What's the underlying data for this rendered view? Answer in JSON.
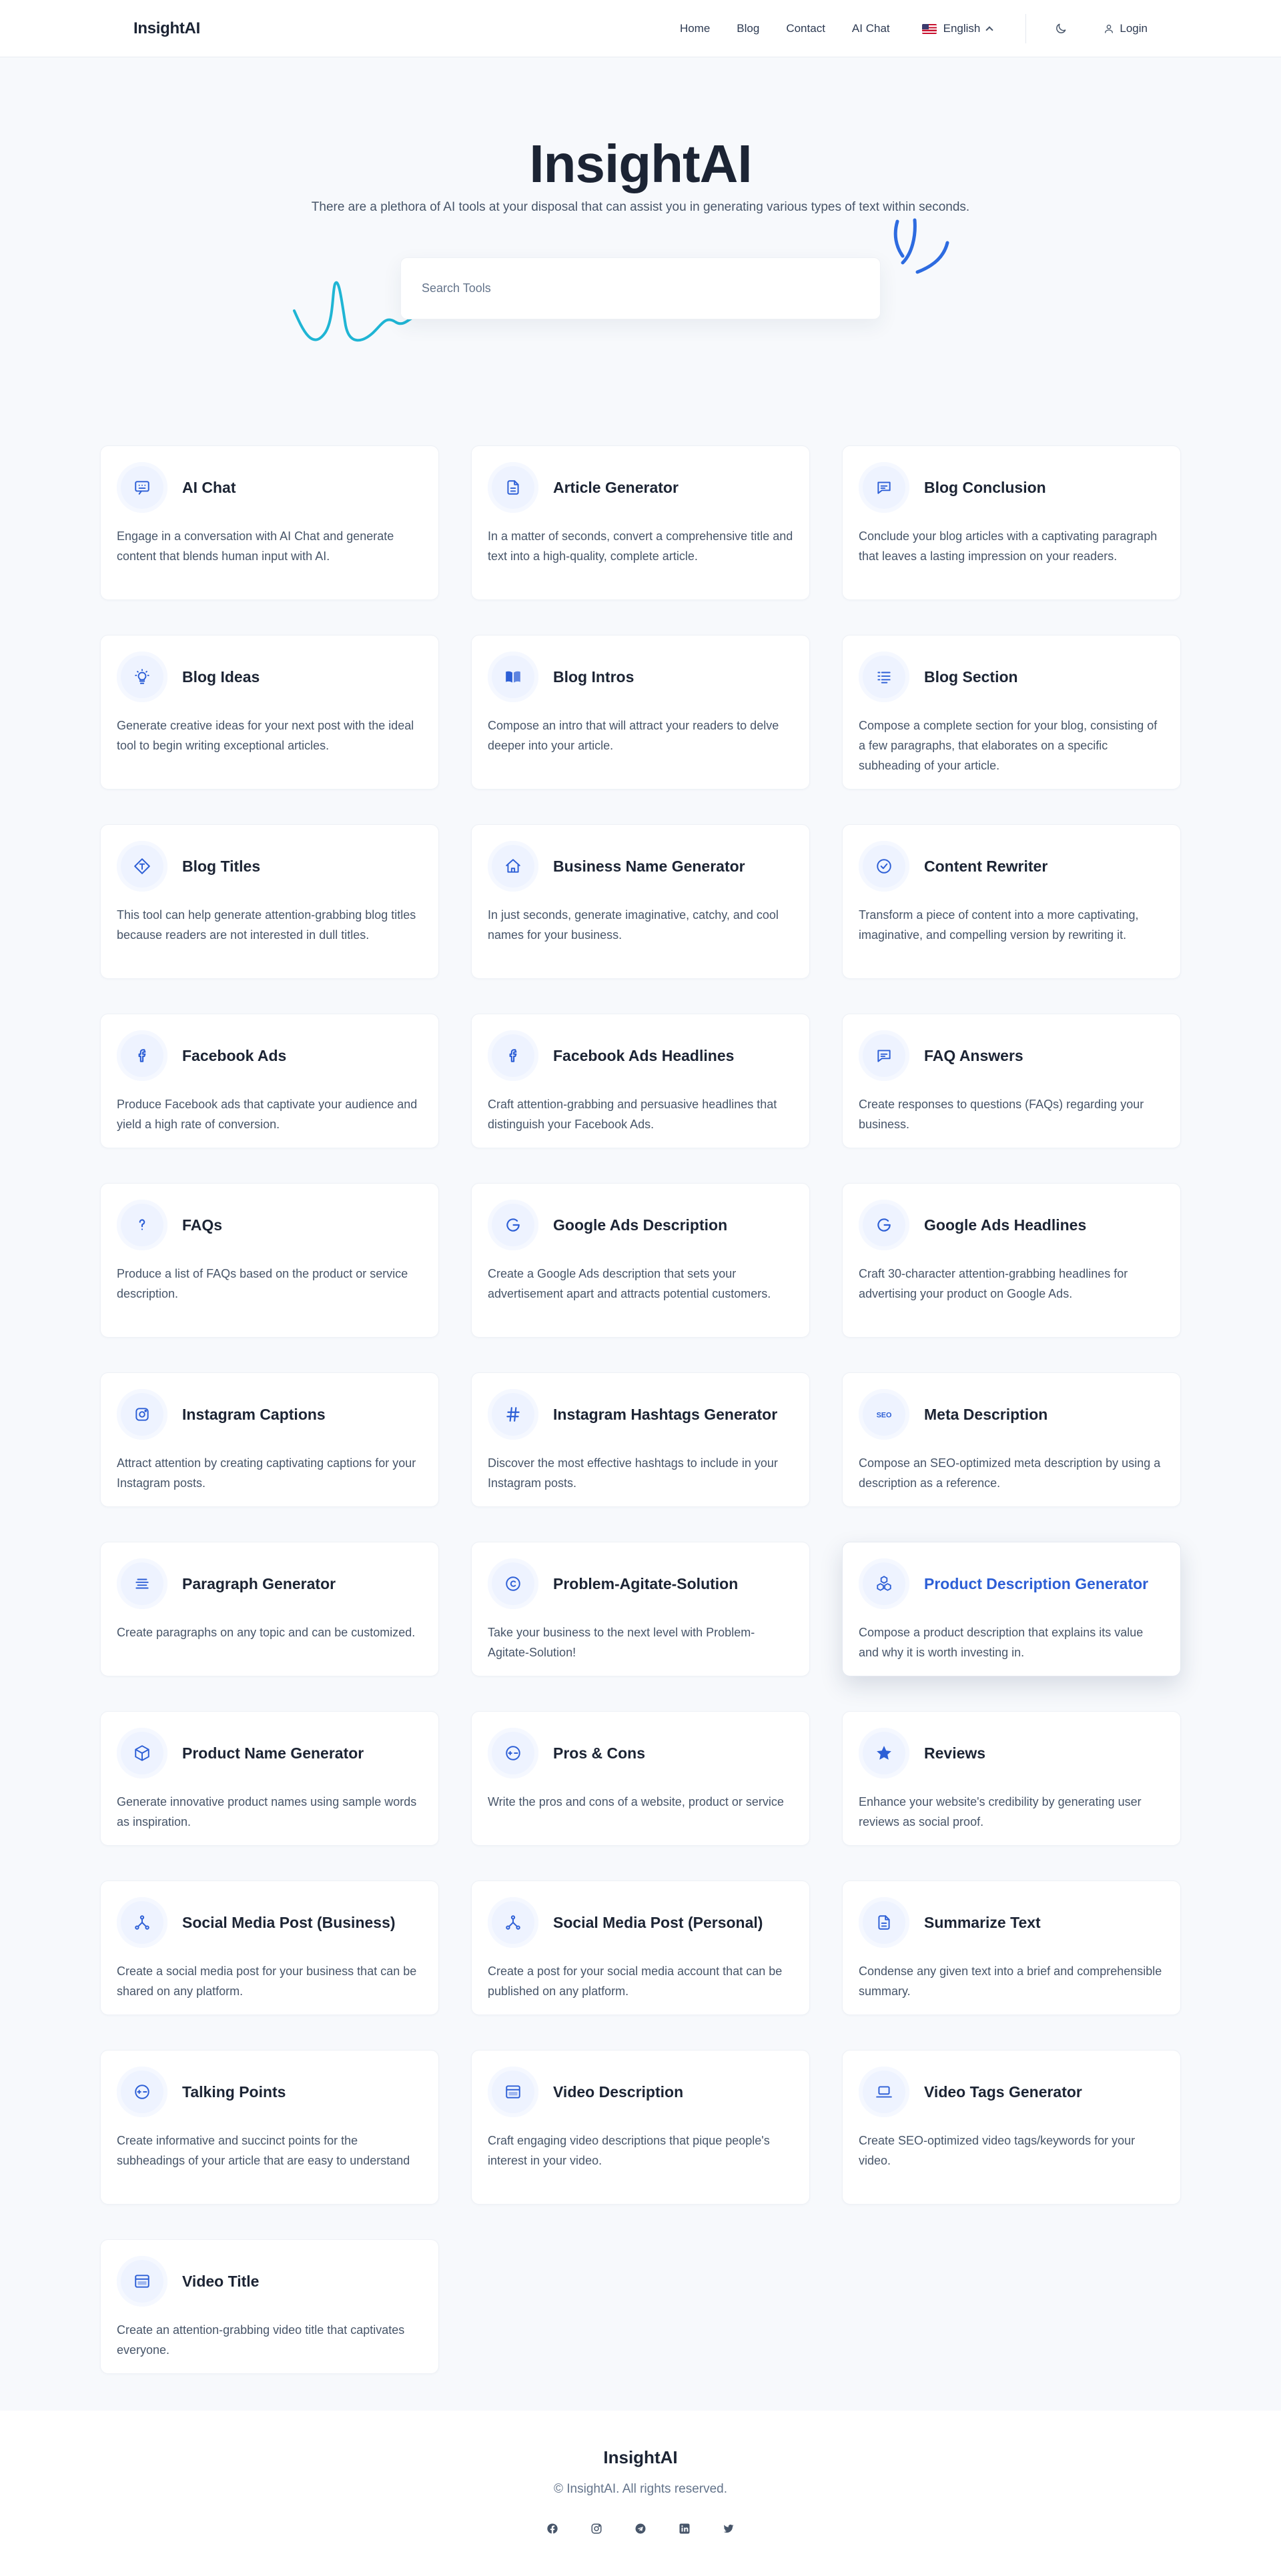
{
  "header": {
    "brand": "InsightAI",
    "nav": [
      "Home",
      "Blog",
      "Contact",
      "AI Chat"
    ],
    "language": "English",
    "login": "Login"
  },
  "hero": {
    "title": "InsightAI",
    "subtitle": "There are a plethora of AI tools at your disposal that can assist you in generating various types of text within seconds.",
    "search_placeholder": "Search Tools"
  },
  "colors": {
    "accent": "#2d5fd6",
    "icon_bg": "#eef3ff",
    "deco_cyan": "#1fb5d4",
    "deco_blue": "#2d6be0"
  },
  "tools": [
    {
      "title": "AI Chat",
      "desc": "Engage in a conversation with AI Chat and generate content that blends human input with AI.",
      "icon": "chat-icon"
    },
    {
      "title": "Article Generator",
      "desc": "In a matter of seconds, convert a comprehensive title and text into a high-quality, complete article.",
      "icon": "document-icon"
    },
    {
      "title": "Blog Conclusion",
      "desc": "Conclude your blog articles with a captivating paragraph that leaves a lasting impression on your readers.",
      "icon": "message-icon"
    },
    {
      "title": "Blog Ideas",
      "desc": "Generate creative ideas for your next post with the ideal tool to begin writing exceptional articles.",
      "icon": "lightbulb-icon"
    },
    {
      "title": "Blog Intros",
      "desc": "Compose an intro that will attract your readers to delve deeper into your article.",
      "icon": "book-icon"
    },
    {
      "title": "Blog Section",
      "desc": "Compose a complete section for your blog, consisting of a few paragraphs, that elaborates on a specific subheading of your article.",
      "icon": "list-icon"
    },
    {
      "title": "Blog Titles",
      "desc": "This tool can help generate attention-grabbing blog titles because readers are not interested in dull titles.",
      "icon": "title-icon"
    },
    {
      "title": "Business Name Generator",
      "desc": "In just seconds, generate imaginative, catchy, and cool names for your business.",
      "icon": "store-icon"
    },
    {
      "title": "Content Rewriter",
      "desc": "Transform a piece of content into a more captivating, imaginative, and compelling version by rewriting it.",
      "icon": "check-circle-icon"
    },
    {
      "title": "Facebook Ads",
      "desc": "Produce Facebook ads that captivate your audience and yield a high rate of conversion.",
      "icon": "facebook-icon"
    },
    {
      "title": "Facebook Ads Headlines",
      "desc": "Craft attention-grabbing and persuasive headlines that distinguish your Facebook Ads.",
      "icon": "facebook-icon"
    },
    {
      "title": "FAQ Answers",
      "desc": "Create responses to questions (FAQs) regarding your business.",
      "icon": "message-icon"
    },
    {
      "title": "FAQs",
      "desc": "Produce a list of FAQs based on the product or service description.",
      "icon": "question-icon"
    },
    {
      "title": "Google Ads Description",
      "desc": "Create a Google Ads description that sets your advertisement apart and attracts potential customers.",
      "icon": "google-icon"
    },
    {
      "title": "Google Ads Headlines",
      "desc": "Craft 30-character attention-grabbing headlines for advertising your product on Google Ads.",
      "icon": "google-icon"
    },
    {
      "title": "Instagram Captions",
      "desc": "Attract attention by creating captivating captions for your Instagram posts.",
      "icon": "instagram-icon"
    },
    {
      "title": "Instagram Hashtags Generator",
      "desc": "Discover the most effective hashtags to include in your Instagram posts.",
      "icon": "hashtag-icon"
    },
    {
      "title": "Meta Description",
      "desc": "Compose an SEO-optimized meta description by using a description as a reference.",
      "icon": "seo-icon"
    },
    {
      "title": "Paragraph Generator",
      "desc": "Create paragraphs on any topic and can be customized.",
      "icon": "paragraph-icon"
    },
    {
      "title": "Problem-Agitate-Solution",
      "desc": "Take your business to the next level with Problem-Agitate-Solution!",
      "icon": "copyright-icon"
    },
    {
      "title": "Product Description Generator",
      "desc": "Compose a product description that explains its value and why it is worth investing in.",
      "icon": "boxes-icon"
    },
    {
      "title": "Product Name Generator",
      "desc": "Generate innovative product names using sample words as inspiration.",
      "icon": "cube-icon"
    },
    {
      "title": "Pros & Cons",
      "desc": "Write the pros and cons of a website, product or service",
      "icon": "plus-minus-icon"
    },
    {
      "title": "Reviews",
      "desc": "Enhance your website's credibility by generating user reviews as social proof.",
      "icon": "star-icon"
    },
    {
      "title": "Social Media Post (Business)",
      "desc": "Create a social media post for your business that can be shared on any platform.",
      "icon": "share-icon"
    },
    {
      "title": "Social Media Post (Personal)",
      "desc": "Create a post for your social media account that can be published on any platform.",
      "icon": "share-icon"
    },
    {
      "title": "Summarize Text",
      "desc": "Condense any given text into a brief and comprehensible summary.",
      "icon": "document-icon"
    },
    {
      "title": "Talking Points",
      "desc": "Create informative and succinct points for the subheadings of your article that are easy to understand",
      "icon": "plus-minus-icon"
    },
    {
      "title": "Video Description",
      "desc": "Craft engaging video descriptions that pique people's interest in your video.",
      "icon": "browser-icon"
    },
    {
      "title": "Video Tags Generator",
      "desc": "Create SEO-optimized video tags/keywords for your video.",
      "icon": "laptop-icon"
    },
    {
      "title": "Video Title",
      "desc": "Create an attention-grabbing video title that captivates everyone.",
      "icon": "browser-icon"
    }
  ],
  "active_tool": "Product Description Generator",
  "footer": {
    "brand": "InsightAI",
    "copyright": "© InsightAI. All rights reserved.",
    "socials": [
      "facebook-icon",
      "instagram-icon",
      "telegram-icon",
      "linkedin-icon",
      "twitter-icon"
    ]
  }
}
